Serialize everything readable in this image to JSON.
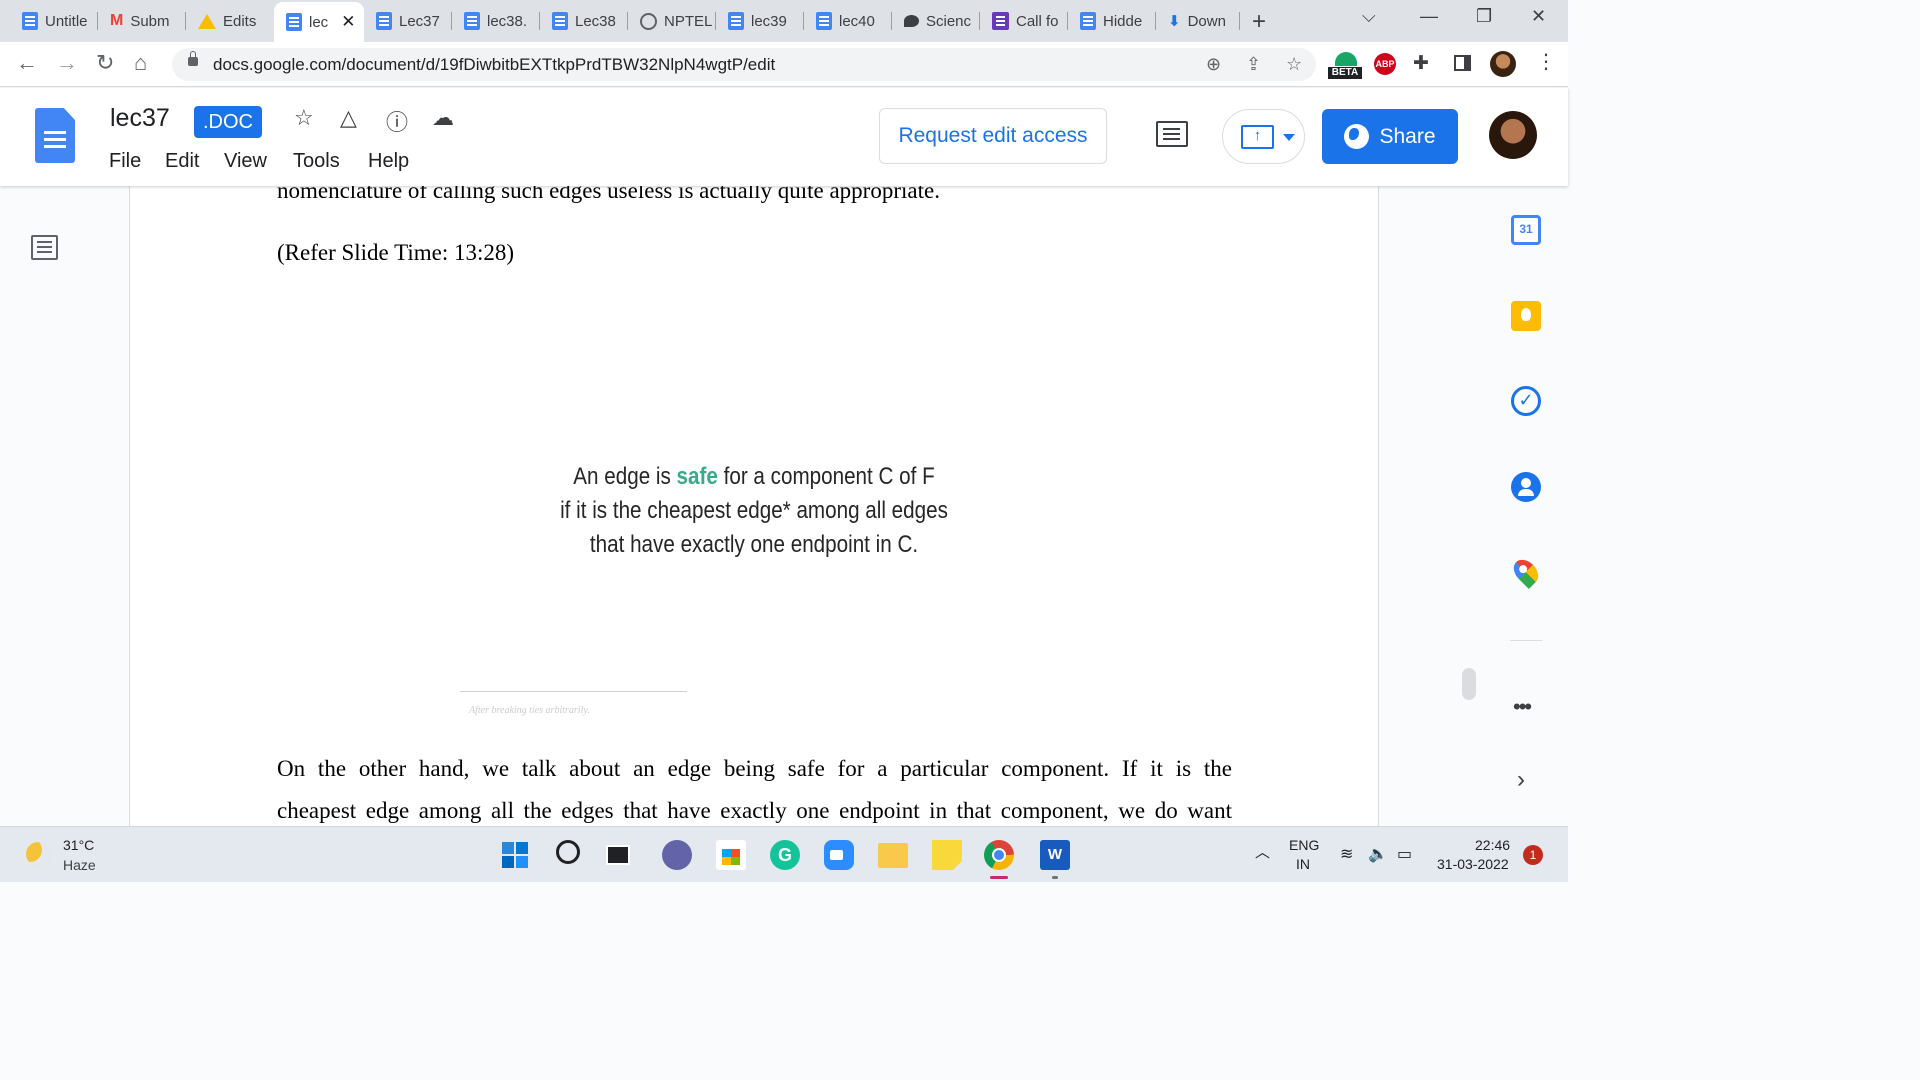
{
  "browser": {
    "tabs": [
      {
        "label": "Untitle",
        "icon": "docs-icon"
      },
      {
        "label": "Subm",
        "icon": "gmail-icon"
      },
      {
        "label": "Edits",
        "icon": "drive-icon"
      },
      {
        "label": "lec",
        "icon": "docs-icon",
        "active": true
      },
      {
        "label": "Lec37",
        "icon": "docs-icon"
      },
      {
        "label": "lec38.",
        "icon": "docs-icon"
      },
      {
        "label": "Lec38",
        "icon": "docs-icon"
      },
      {
        "label": "NPTEL",
        "icon": "globe-icon"
      },
      {
        "label": "lec39",
        "icon": "docs-icon"
      },
      {
        "label": "lec40",
        "icon": "docs-icon"
      },
      {
        "label": "Scienc",
        "icon": "chat-icon"
      },
      {
        "label": "Call fo",
        "icon": "forms-icon"
      },
      {
        "label": "Hidde",
        "icon": "docs-icon"
      },
      {
        "label": "Down",
        "icon": "download-icon"
      }
    ],
    "url": "docs.google.com/document/d/19fDiwbitbEXTtkpPrdTBW32NlpN4wgtP/edit",
    "extensions": {
      "beta_label": "BETA",
      "abp_label": "ABP"
    }
  },
  "docs": {
    "title": "lec37",
    "badge": ".DOC",
    "menu": [
      "File",
      "Edit",
      "View",
      "Tools",
      "Help"
    ],
    "request_edit_label": "Request edit access",
    "share_label": "Share",
    "accent": "#1a73e8"
  },
  "document": {
    "top_line": "nomenclature of calling such edges useless is actually quite appropriate.",
    "refer_line": "(Refer Slide Time: 13:28)",
    "slide": {
      "line1_prefix": "An edge is ",
      "line1_highlight": "safe",
      "line1_suffix": " for a component C of F",
      "line2": "if it is the cheapest edge* among all edges",
      "line3": "that have exactly one endpoint in C.",
      "footnote": "After breaking ties arbitrarily.",
      "highlight_color": "#3aa88a"
    },
    "para_line1": "On the other hand, we talk about an edge being safe for a particular component. If it is the",
    "para_line2": "cheapest edge among all the edges that have exactly one endpoint in that component, we do want"
  },
  "side_panel": {
    "calendar_day": "31"
  },
  "taskbar": {
    "weather_temp": "31°C",
    "weather_desc": "Haze",
    "lang_top": "ENG",
    "lang_bottom": "IN",
    "time": "22:46",
    "date": "31-03-2022",
    "notifications": "1",
    "grammarly_letter": "G",
    "word_letter": "W"
  }
}
